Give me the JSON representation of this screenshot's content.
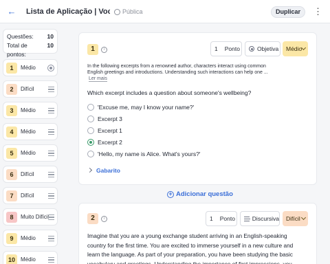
{
  "header": {
    "title": "Lista de Aplicação | Vocabu...",
    "visibility": "Pública",
    "duplicate_label": "Duplicar"
  },
  "stats": {
    "questions_label": "Questões:",
    "questions_value": "10",
    "points_label": "Total de pontos:",
    "points_value": "10"
  },
  "sidebar": {
    "items": [
      {
        "number": "1",
        "difficulty": "Médio",
        "color": "#fbe7a6"
      },
      {
        "number": "2",
        "difficulty": "Difícil",
        "color": "#fbdcc4"
      },
      {
        "number": "3",
        "difficulty": "Médio",
        "color": "#fbe7a6"
      },
      {
        "number": "4",
        "difficulty": "Médio",
        "color": "#fbe7a6"
      },
      {
        "number": "5",
        "difficulty": "Médio",
        "color": "#fbe7a6"
      },
      {
        "number": "6",
        "difficulty": "Difícil",
        "color": "#fbdcc4"
      },
      {
        "number": "7",
        "difficulty": "Difícil",
        "color": "#fbdcc4"
      },
      {
        "number": "8",
        "difficulty": "Muito Difícil",
        "color": "#f7c6c6"
      },
      {
        "number": "9",
        "difficulty": "Médio",
        "color": "#fbe7a6"
      },
      {
        "number": "10",
        "difficulty": "Médio",
        "color": "#fbe7a6"
      }
    ]
  },
  "q1": {
    "number": "1",
    "points_value": "1",
    "points_unit": "Ponto",
    "type": "Objetiva",
    "difficulty": "Médio",
    "context_line1": "In the following excerpts from a renowned author, characters interact using common",
    "context_line2": "English greetings and introductions. Understanding such interactions can help one ...",
    "read_more": "Ler mais",
    "prompt": "Which excerpt includes a question about someone's wellbeing?",
    "options": [
      {
        "text": "'Excuse me, may I know your name?'",
        "selected": false
      },
      {
        "text": "Excerpt 3",
        "selected": false
      },
      {
        "text": "Excerpt 1",
        "selected": false
      },
      {
        "text": "Excerpt 2",
        "selected": true
      },
      {
        "text": "'Hello, my name is Alice. What's yours?'",
        "selected": false
      }
    ],
    "answer_key": "Gabarito"
  },
  "add_question": "Adicionar questão",
  "q2": {
    "number": "2",
    "points_value": "1",
    "points_unit": "Ponto",
    "type": "Discursiva",
    "difficulty": "Difícil",
    "text_lines": [
      "Imagine that you are a young exchange student arriving in an English-speaking",
      "country for the first time. You are excited to immerse yourself in a new culture and",
      "learn the language. As part of your preparation, you have been studying the basic",
      "vocabulary and greetings. Understanding the importance of first impressions, you"
    ]
  },
  "colors": {
    "accent": "#3b6fd8",
    "medio": "#fbe7a6",
    "dificil": "#fbdcc4",
    "muito_dificil": "#f7c6c6",
    "selected": "#3a9a6a"
  }
}
